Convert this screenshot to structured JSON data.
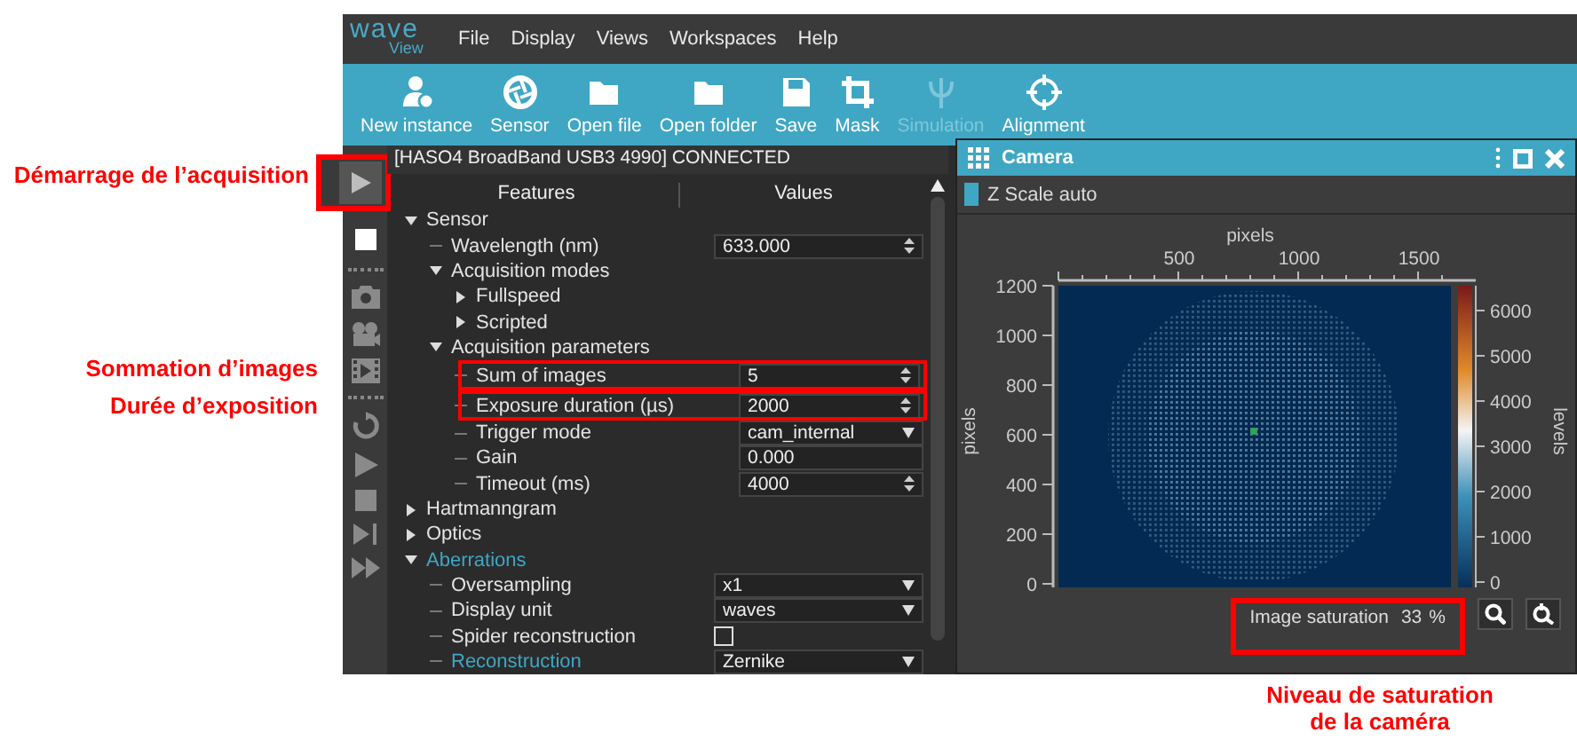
{
  "annotations": [
    {
      "text": "Démarrage de l’acquisition"
    },
    {
      "text": "Sommation d’images"
    },
    {
      "text": "Durée d’exposition"
    },
    {
      "text": "Niveau de saturation de la caméra"
    }
  ],
  "logo": {
    "top": "wave",
    "bottom": "View"
  },
  "menu": [
    "File",
    "Display",
    "Views",
    "Workspaces",
    "Help"
  ],
  "toolbar": [
    {
      "label": "New instance",
      "disabled": false
    },
    {
      "label": "Sensor",
      "disabled": false
    },
    {
      "label": "Open file",
      "disabled": false
    },
    {
      "label": "Open folder",
      "disabled": false
    },
    {
      "label": "Save",
      "disabled": false
    },
    {
      "label": "Mask",
      "disabled": false
    },
    {
      "label": "Simulation",
      "disabled": true
    },
    {
      "label": "Alignment",
      "disabled": false
    }
  ],
  "device_status": "[HASO4 BroadBand USB3 4990] CONNECTED",
  "tree": {
    "columns": [
      "Features",
      "Values"
    ],
    "items": [
      {
        "label": "Sensor",
        "kind": "group",
        "expanded": true,
        "highlighted": false,
        "children": [
          {
            "label": "Wavelength (nm)",
            "kind": "spin",
            "value": "633.000",
            "highlighted": false
          },
          {
            "label": "Acquisition modes",
            "kind": "group",
            "expanded": true,
            "highlighted": false,
            "children": [
              {
                "label": "Fullspeed",
                "kind": "group",
                "expanded": false,
                "highlighted": false
              },
              {
                "label": "Scripted",
                "kind": "group",
                "expanded": false,
                "highlighted": false
              }
            ]
          },
          {
            "label": "Acquisition parameters",
            "kind": "group",
            "expanded": true,
            "highlighted": false,
            "children": [
              {
                "label": "Sum of images",
                "kind": "spin",
                "value": "5",
                "highlighted": false
              },
              {
                "label": "Exposure duration (µs)",
                "kind": "spin",
                "value": "2000",
                "highlighted": false
              },
              {
                "label": "Trigger mode",
                "kind": "dropdown",
                "value": "cam_internal",
                "highlighted": false
              },
              {
                "label": "Gain",
                "kind": "field",
                "value": "0.000",
                "highlighted": false
              },
              {
                "label": "Timeout (ms)",
                "kind": "spin",
                "value": "4000",
                "highlighted": false
              }
            ]
          }
        ]
      },
      {
        "label": "Hartmanngram",
        "kind": "group",
        "expanded": false,
        "highlighted": false
      },
      {
        "label": "Optics",
        "kind": "group",
        "expanded": false,
        "highlighted": false
      },
      {
        "label": "Aberrations",
        "kind": "group",
        "expanded": true,
        "highlighted": true,
        "children": [
          {
            "label": "Oversampling",
            "kind": "dropdown",
            "value": "x1",
            "highlighted": false
          },
          {
            "label": "Display unit",
            "kind": "dropdown",
            "value": "waves",
            "highlighted": false
          },
          {
            "label": "Spider reconstruction",
            "kind": "checkbox",
            "checked": false,
            "highlighted": false
          },
          {
            "label": "Reconstruction",
            "kind": "dropdown",
            "value": "Zernike",
            "highlighted": true
          }
        ]
      }
    ]
  },
  "camera": {
    "title": "Camera",
    "z_scale": {
      "label": "Z Scale auto",
      "checked": true
    },
    "x_axis": {
      "label": "pixels",
      "ticks": [
        "500",
        "1000",
        "1500"
      ]
    },
    "y_axis": {
      "label": "pixels",
      "ticks": [
        "1200",
        "1000",
        "800",
        "600",
        "400",
        "200",
        "0"
      ]
    },
    "colorbar": {
      "label": "levels",
      "ticks": [
        "6000",
        "5000",
        "4000",
        "3000",
        "2000",
        "1000",
        "0"
      ]
    },
    "saturation": {
      "label": "Image saturation",
      "value": "33",
      "unit": "%"
    }
  }
}
